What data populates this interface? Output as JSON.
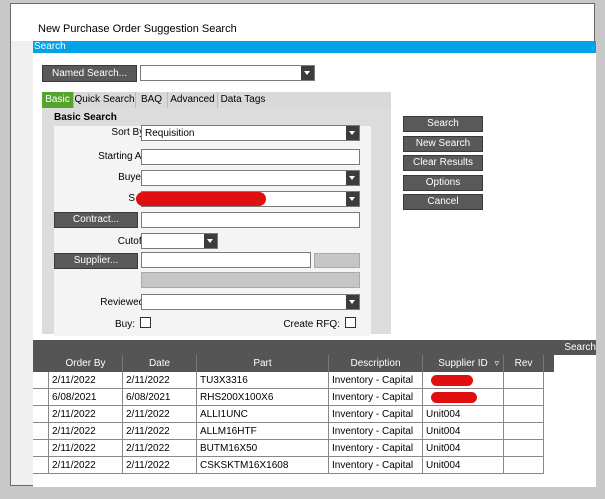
{
  "window": {
    "title": "New Purchase Order Suggestion Search"
  },
  "search_bar": {
    "label": "Search"
  },
  "named_search": {
    "button_label": "Named Search...",
    "value": ""
  },
  "tabs": [
    "Basic",
    "Quick Search",
    "BAQ",
    "Advanced",
    "Data Tags"
  ],
  "basic": {
    "heading": "Basic Search",
    "sort_by_label": "Sort By:",
    "sort_by_value": "Requisition",
    "starting_at_label": "Starting At:",
    "buyer_label": "Buyer:",
    "site_label": "S",
    "contract_button": "Contract...",
    "cutoff_label": "Cutoff:",
    "supplier_button": "Supplier...",
    "reviewed_label": "Reviewed:",
    "buy_label": "Buy:",
    "create_rfq_label": "Create RFQ:"
  },
  "actions": {
    "search": "Search",
    "new_search": "New Search",
    "clear_results": "Clear Results",
    "options": "Options",
    "cancel": "Cancel"
  },
  "grid": {
    "top_label": "Search",
    "columns": [
      "Order By",
      "Date",
      "Part",
      "Description",
      "Supplier ID",
      "Rev"
    ],
    "rows": [
      [
        "2/11/2022",
        "2/11/2022",
        "TU3X3316",
        "Inventory - Capital",
        "",
        ""
      ],
      [
        "6/08/2021",
        "6/08/2021",
        "RHS200X100X6",
        "Inventory - Capital",
        "",
        ""
      ],
      [
        "2/11/2022",
        "2/11/2022",
        "ALLI1UNC",
        "Inventory - Capital",
        "Unit004",
        ""
      ],
      [
        "2/11/2022",
        "2/11/2022",
        "ALLM16HTF",
        "Inventory - Capital",
        "Unit004",
        ""
      ],
      [
        "2/11/2022",
        "2/11/2022",
        "BUTM16X50",
        "Inventory - Capital",
        "Unit004",
        ""
      ],
      [
        "2/11/2022",
        "2/11/2022",
        "CSKSKTM16X1608",
        "Inventory - Capital",
        "Unit004",
        ""
      ]
    ]
  },
  "colors": {
    "accent_blue": "#00a2e8",
    "tab_active": "#56a42d",
    "button": "#595959",
    "redaction": "#e01010"
  }
}
